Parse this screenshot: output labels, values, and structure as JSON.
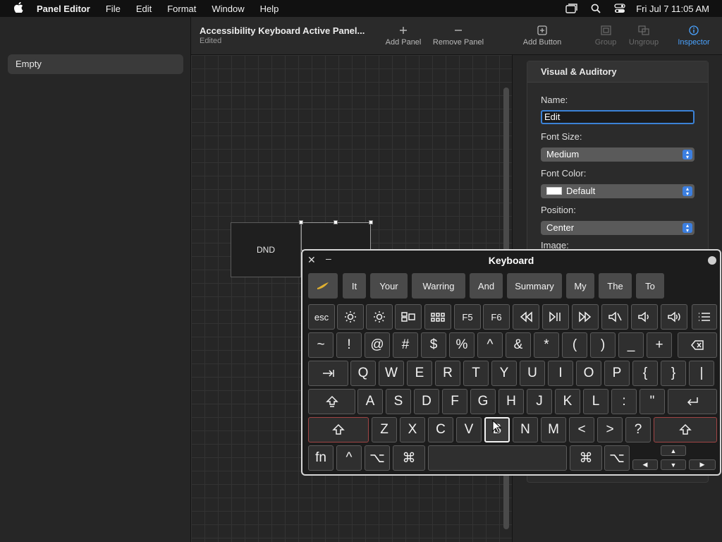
{
  "menubar": {
    "app_name": "Panel Editor",
    "menus": [
      "File",
      "Edit",
      "Format",
      "Window",
      "Help"
    ],
    "clock": "Fri Jul 7  11:05 AM"
  },
  "sidebar": {
    "selected_item": "Empty"
  },
  "toolbar": {
    "doc_title": "Accessibility Keyboard Active Panel...",
    "doc_status": "Edited",
    "add_panel": "Add Panel",
    "remove_panel": "Remove Panel",
    "add_button": "Add Button",
    "group": "Group",
    "ungroup": "Ungroup",
    "inspector": "Inspector"
  },
  "canvas": {
    "button_dnd": "DND"
  },
  "inspector": {
    "section_title": "Visual & Auditory",
    "name_label": "Name:",
    "name_value": "Edit",
    "font_size_label": "Font Size:",
    "font_size_value": "Medium",
    "font_color_label": "Font Color:",
    "font_color_value": "Default",
    "position_label": "Position:",
    "position_value": "Center",
    "image_label": "Image:"
  },
  "keyboard": {
    "title": "Keyboard",
    "suggestions": [
      "It",
      "Your",
      "Warring",
      "And",
      "Summary",
      "My",
      "The",
      "To"
    ],
    "fn_row": [
      "esc",
      "F5",
      "F6"
    ],
    "row_symbols": [
      "~",
      "!",
      "@",
      "#",
      "$",
      "%",
      "^",
      "&",
      "*",
      "(",
      ")",
      "_",
      "+"
    ],
    "row_qwerty": [
      "Q",
      "W",
      "E",
      "R",
      "T",
      "Y",
      "U",
      "I",
      "O",
      "P",
      "{",
      "}",
      "|"
    ],
    "row_home": [
      "A",
      "S",
      "D",
      "F",
      "G",
      "H",
      "J",
      "K",
      "L",
      ":",
      "\""
    ],
    "row_bottom": [
      "Z",
      "X",
      "C",
      "V",
      "B",
      "N",
      "M",
      "<",
      ">",
      "?"
    ],
    "mod_keys": {
      "fn": "fn",
      "control": "^",
      "option": "⌥",
      "command": "⌘"
    }
  },
  "colors": {
    "accent": "#3b82d6",
    "inspector_active": "#4aa3ff",
    "shift_border": "#a04545"
  }
}
